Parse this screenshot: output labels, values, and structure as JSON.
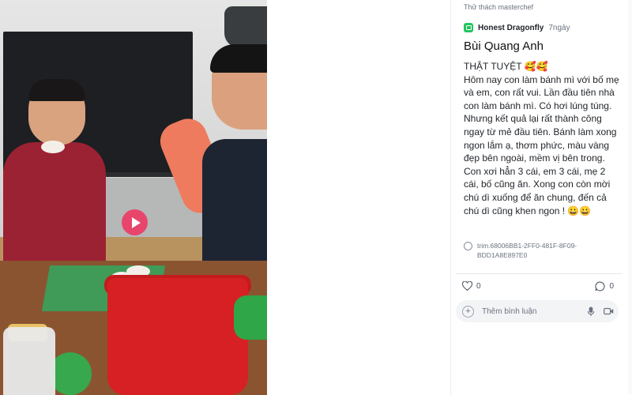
{
  "breadcrumb": "Thử thách masterchef",
  "author": {
    "name": "Honest Dragonfly",
    "time": "7ngày"
  },
  "post": {
    "title": "Bùi Quang Anh",
    "body": "THẬT TUYỆT 🥰🥰\nHôm nay con làm bánh mì với bố mẹ và em, con rất vui. Lần đầu tiên nhà con làm bánh mì. Có hơi lúng túng. Nhưng kết quả lại rất thành công ngay từ mẻ đầu tiên. Bánh làm xong ngon lắm ạ, thơm phức, màu vàng đẹp bên ngoài, mềm vị bên trong. Con xơi hẳn 3 cái, em 3 cái, mẹ 2 cái, bố cũng ăn. Xong con còn mời chú dì xuống để ăn chung, đến cả chú dì cũng khen ngon ! 😀😀"
  },
  "attachment": {
    "name": "trim.68006BB1-2FF0-481F-8F09-BDD1A8E897E0",
    "icon": "attachment-icon"
  },
  "reactions": {
    "likes": "0",
    "comments": "0"
  },
  "comment_box": {
    "placeholder": "Thêm bình luận"
  },
  "video": {
    "play_icon": "play-icon"
  },
  "colors": {
    "accent": "#e8456c",
    "author_icon": "#22c55e"
  }
}
